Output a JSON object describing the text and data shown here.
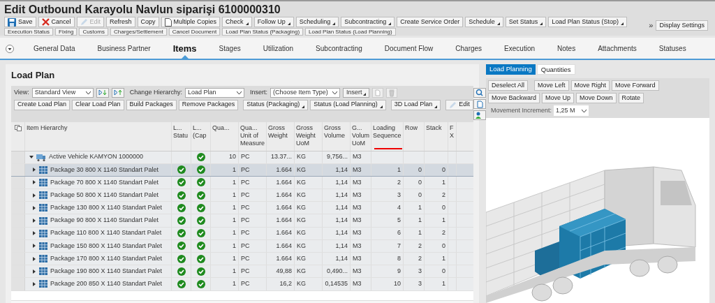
{
  "title": "Edit Outbound Karayolu Navlun siparişi 6100000310",
  "toolbar": [
    {
      "label": "Save",
      "menu": false,
      "disabled": false
    },
    {
      "label": "Cancel",
      "menu": false,
      "disabled": false
    },
    {
      "label": "Edit",
      "menu": false,
      "disabled": true
    },
    {
      "label": "Refresh",
      "menu": false,
      "disabled": false
    },
    {
      "label": "Copy",
      "menu": false,
      "disabled": false
    },
    {
      "label": "Multiple Copies",
      "menu": false,
      "disabled": false
    },
    {
      "label": "Check",
      "menu": true,
      "disabled": false
    },
    {
      "label": "Follow Up",
      "menu": true,
      "disabled": false
    },
    {
      "label": "Scheduling",
      "menu": true,
      "disabled": false
    },
    {
      "label": "Subcontracting",
      "menu": true,
      "disabled": false
    },
    {
      "label": "Create Service Order",
      "menu": false,
      "disabled": false
    },
    {
      "label": "Schedule",
      "menu": true,
      "disabled": false
    },
    {
      "label": "Set Status",
      "menu": true,
      "disabled": false
    },
    {
      "label": "Load Plan Status (Stop)",
      "menu": true,
      "disabled": false
    }
  ],
  "toolbar_row_2": [
    "Execution Status",
    "Fixing",
    "Customs",
    "Charges/Settlement",
    "Cancel Document",
    "Load Plan Status (Packaging)",
    "Load Plan Status (Load Planning)"
  ],
  "overflow": "»",
  "display_settings": "Display Settings",
  "tabs": [
    {
      "label": "General Data",
      "selected": false
    },
    {
      "label": "Business Partner",
      "selected": false
    },
    {
      "label": "Items",
      "selected": true
    },
    {
      "label": "Stages",
      "selected": false
    },
    {
      "label": "Utilization",
      "selected": false
    },
    {
      "label": "Subcontracting",
      "selected": false
    },
    {
      "label": "Document Flow",
      "selected": false
    },
    {
      "label": "Charges",
      "selected": false
    },
    {
      "label": "Execution",
      "selected": false
    },
    {
      "label": "Notes",
      "selected": false
    },
    {
      "label": "Attachments",
      "selected": false
    },
    {
      "label": "Statuses",
      "selected": false
    }
  ],
  "load_plan": {
    "title": "Load Plan",
    "view_label": "View:",
    "view_value": "Standard View",
    "hierarchy_label": "Change Hierarchy:",
    "hierarchy_value": "Load Plan",
    "insert_label": "Insert:",
    "insert_value": "(Choose Item Type)",
    "insert_button": "Insert",
    "buttons": [
      {
        "label": "Create Load Plan",
        "menu": false
      },
      {
        "label": "Clear Load Plan",
        "menu": false
      },
      {
        "label": "Build Packages",
        "menu": false
      },
      {
        "label": "Remove Packages",
        "menu": false
      },
      {
        "label": "Status (Packaging)",
        "menu": true
      },
      {
        "label": "Status (Load Planning)",
        "menu": true
      },
      {
        "label": "3D Load Plan",
        "menu": true
      },
      {
        "label": "Edit",
        "menu": false
      }
    ],
    "columns": [
      "Item Hierarchy",
      "L... Statu",
      "L... (Cap",
      "Qua...",
      "Qua... Unit of Measure",
      "Gross Weight",
      "Gross Weight UoM",
      "Gross Volume",
      "G... Volum UoM",
      "Loading Sequence",
      "Row",
      "Stack",
      "F X"
    ],
    "rows": [
      {
        "kind": "vehicle",
        "name": "Active Vehicle KAMYON 1000000",
        "expanded": true,
        "selected": false,
        "status_1": false,
        "status_2": true,
        "qty": "10",
        "uom": "PC",
        "weight": "13.37...",
        "weight_uom": "KG",
        "volume": "9,756...",
        "volume_uom": "M3",
        "sequence": "",
        "row": "",
        "stack": ""
      },
      {
        "kind": "package",
        "name": "Package 30 800 X 1140 Standart Palet",
        "expanded": false,
        "selected": true,
        "status_1": true,
        "status_2": true,
        "qty": "1",
        "uom": "PC",
        "weight": "1.664",
        "weight_uom": "KG",
        "volume": "1,14",
        "volume_uom": "M3",
        "sequence": "1",
        "row": "0",
        "stack": "0"
      },
      {
        "kind": "package",
        "name": "Package 70 800 X 1140 Standart Palet",
        "expanded": false,
        "selected": false,
        "status_1": true,
        "status_2": true,
        "qty": "1",
        "uom": "PC",
        "weight": "1.664",
        "weight_uom": "KG",
        "volume": "1,14",
        "volume_uom": "M3",
        "sequence": "2",
        "row": "0",
        "stack": "1"
      },
      {
        "kind": "package",
        "name": "Package 50 800 X 1140 Standart Palet",
        "expanded": false,
        "selected": false,
        "status_1": true,
        "status_2": true,
        "qty": "1",
        "uom": "PC",
        "weight": "1.664",
        "weight_uom": "KG",
        "volume": "1,14",
        "volume_uom": "M3",
        "sequence": "3",
        "row": "0",
        "stack": "2"
      },
      {
        "kind": "package",
        "name": "Package 130 800 X 1140 Standart Palet",
        "expanded": false,
        "selected": false,
        "status_1": true,
        "status_2": true,
        "qty": "1",
        "uom": "PC",
        "weight": "1.664",
        "weight_uom": "KG",
        "volume": "1,14",
        "volume_uom": "M3",
        "sequence": "4",
        "row": "1",
        "stack": "0"
      },
      {
        "kind": "package",
        "name": "Package 90 800 X 1140 Standart Palet",
        "expanded": false,
        "selected": false,
        "status_1": true,
        "status_2": true,
        "qty": "1",
        "uom": "PC",
        "weight": "1.664",
        "weight_uom": "KG",
        "volume": "1,14",
        "volume_uom": "M3",
        "sequence": "5",
        "row": "1",
        "stack": "1"
      },
      {
        "kind": "package",
        "name": "Package 110 800 X 1140 Standart Palet",
        "expanded": false,
        "selected": false,
        "status_1": true,
        "status_2": true,
        "qty": "1",
        "uom": "PC",
        "weight": "1.664",
        "weight_uom": "KG",
        "volume": "1,14",
        "volume_uom": "M3",
        "sequence": "6",
        "row": "1",
        "stack": "2"
      },
      {
        "kind": "package",
        "name": "Package 150 800 X 1140 Standart Palet",
        "expanded": false,
        "selected": false,
        "status_1": true,
        "status_2": true,
        "qty": "1",
        "uom": "PC",
        "weight": "1.664",
        "weight_uom": "KG",
        "volume": "1,14",
        "volume_uom": "M3",
        "sequence": "7",
        "row": "2",
        "stack": "0"
      },
      {
        "kind": "package",
        "name": "Package 170 800 X 1140 Standart Palet",
        "expanded": false,
        "selected": false,
        "status_1": true,
        "status_2": true,
        "qty": "1",
        "uom": "PC",
        "weight": "1.664",
        "weight_uom": "KG",
        "volume": "1,14",
        "volume_uom": "M3",
        "sequence": "8",
        "row": "2",
        "stack": "1"
      },
      {
        "kind": "package",
        "name": "Package 190 800 X 1140 Standart Palet",
        "expanded": false,
        "selected": false,
        "status_1": true,
        "status_2": true,
        "qty": "1",
        "uom": "PC",
        "weight": "49,88",
        "weight_uom": "KG",
        "volume": "0,490...",
        "volume_uom": "M3",
        "sequence": "9",
        "row": "3",
        "stack": "0"
      },
      {
        "kind": "package",
        "name": "Package 200 850 X 1140 Standart Palet",
        "expanded": false,
        "selected": false,
        "status_1": true,
        "status_2": true,
        "qty": "1",
        "uom": "PC",
        "weight": "16,2",
        "weight_uom": "KG",
        "volume": "0,14535",
        "volume_uom": "M3",
        "sequence": "10",
        "row": "3",
        "stack": "1"
      }
    ]
  },
  "planner": {
    "tabs": [
      {
        "label": "Load Planning",
        "selected": true
      },
      {
        "label": "Quantities",
        "selected": false
      }
    ],
    "buttons": [
      "Deselect All",
      "Move Left",
      "Move Right",
      "Move Forward",
      "Move Backward",
      "Move Up",
      "Move Down",
      "Rotate"
    ],
    "increment_label": "Movement Increment:",
    "increment_value": "1,25 M"
  }
}
